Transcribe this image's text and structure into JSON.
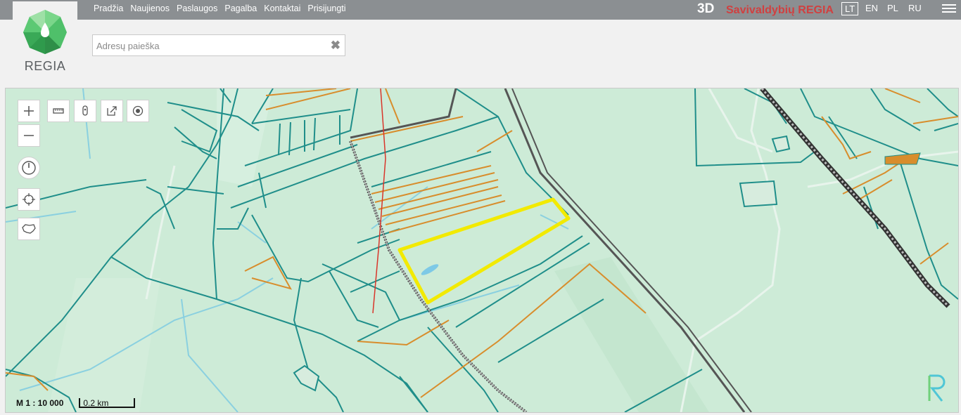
{
  "header": {
    "logo_text": "REGIA",
    "nav": [
      "Pradžia",
      "Naujienos",
      "Paslaugos",
      "Pagalba",
      "Kontaktai",
      "Prisijungti"
    ],
    "btn_3d": "3D",
    "brand": "Savivaldybių REGIA",
    "languages": [
      {
        "code": "LT",
        "active": true
      },
      {
        "code": "EN",
        "active": false
      },
      {
        "code": "PL",
        "active": false
      },
      {
        "code": "RU",
        "active": false
      }
    ]
  },
  "search": {
    "placeholder": "Adresų paieška",
    "value": ""
  },
  "map": {
    "scale_label": "M 1 : 10 000",
    "scale_bar": "0.2 km",
    "colors": {
      "parcel": "#1f8e8a",
      "orange_line": "#d88d2c",
      "highlight": "#f2ea00",
      "red_line": "#d9352a",
      "railway": "#555555",
      "background": "#cdebd7"
    }
  },
  "icons": {
    "zoom_in": "plus-icon",
    "zoom_out": "minus-icon",
    "measure": "ruler-icon",
    "marker": "marker-icon",
    "share": "share-icon",
    "point": "target-dot-icon",
    "clock": "clock-icon",
    "locate": "crosshair-icon",
    "country": "lithuania-outline-icon"
  }
}
